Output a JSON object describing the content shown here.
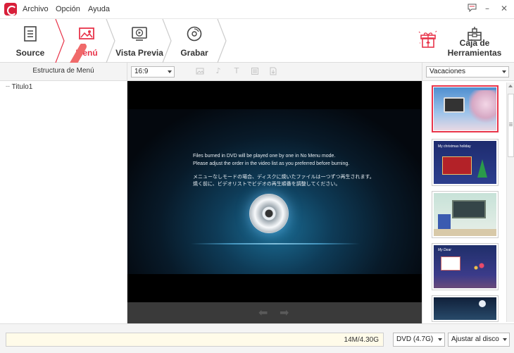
{
  "menu": {
    "file": "Archivo",
    "option": "Opción",
    "help": "Ayuda"
  },
  "window_controls": {
    "feedback": "feedback-icon",
    "minimize": "–",
    "close": "✕"
  },
  "steps": [
    {
      "label": "Source",
      "icon": "document-icon"
    },
    {
      "label": "Menú",
      "icon": "image-menu-icon",
      "active": true
    },
    {
      "label": "Vista Previa",
      "icon": "play-preview-icon"
    },
    {
      "label": "Grabar",
      "icon": "burn-disc-icon"
    }
  ],
  "tools": {
    "gift_icon": "gift-icon",
    "toolbox_label": "Caja de Herramientas"
  },
  "left_panel": {
    "header": "Estructura de Menú",
    "tree": [
      "Titulo1"
    ]
  },
  "center": {
    "aspect_ratio": "16:9",
    "message_lines": [
      "Files burned in DVD will be played one by one in No Menu mode.",
      "Please adjust the order in the video list as you preferred before burning.",
      "メニューなしモードの場合、ディスクに焼いたファイルは一つずつ再生されます。",
      "焼く前に、ビデオリストでビデオの再生順番を調整してください。"
    ]
  },
  "right_panel": {
    "template_category": "Vacaciones",
    "thumb_titles": [
      "",
      "My christmas holiday",
      "",
      "My Dear",
      ""
    ]
  },
  "bottom": {
    "disk_usage": "14M/4.30G",
    "disc_type": "DVD (4.7G)",
    "fit_label": "Ajustar al disco"
  },
  "colors": {
    "accent": "#e8344a"
  }
}
